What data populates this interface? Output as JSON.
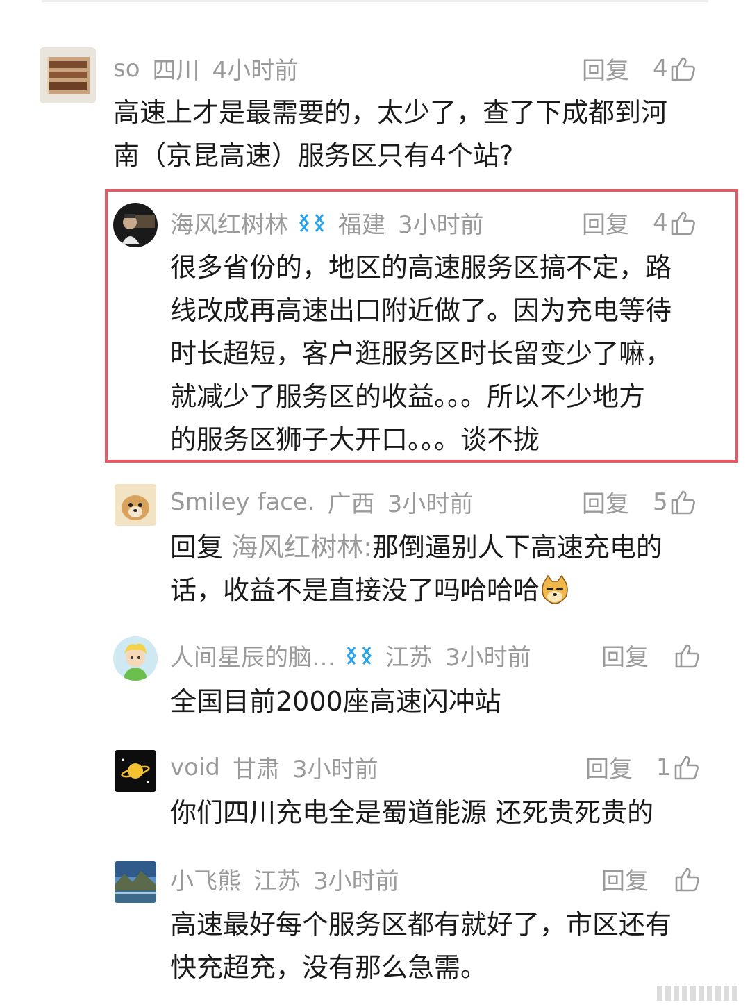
{
  "actions": {
    "reply_label": "回复"
  },
  "comments": [
    {
      "name": "so",
      "region": "四川",
      "time": "4小时前",
      "likes": "4",
      "text_lines": [
        "高速上才是最需要的，太少了，查了下成都到河",
        "南（京昆高速）服务区只有4个站?"
      ]
    },
    {
      "name": "海风红树林",
      "region": "福建",
      "time": "3小时前",
      "likes": "4",
      "text_lines": [
        "很多省份的，地区的高速服务区搞不定，路",
        "线改成再高速出口附近做了。因为充电等待",
        "时长超短，客户逛服务区时长留变少了嘛，",
        "就减少了服务区的收益。。。所以不少地方",
        "的服务区狮子大开口。。。谈不拢"
      ]
    },
    {
      "name": "Smiley face.",
      "region": "广西",
      "time": "3小时前",
      "likes": "5",
      "reply_prefix": "回复",
      "reply_to": "海风红树林:",
      "text_lines": [
        "那倒逼别人下高速充电的",
        "话，收益不是直接没了吗哈哈哈"
      ]
    },
    {
      "name": "人间星辰的脑…",
      "region": "江苏",
      "time": "3小时前",
      "likes": "",
      "text_lines": [
        "全国目前2000座高速闪冲站"
      ]
    },
    {
      "name": "void",
      "region": "甘肃",
      "time": "3小时前",
      "likes": "1",
      "text_lines": [
        "你们四川充电全是蜀道能源 还死贵死贵的"
      ]
    },
    {
      "name": "小飞熊",
      "region": "江苏",
      "time": "3小时前",
      "likes": "",
      "text_lines": [
        "高速最好每个服务区都有就好了，市区还有",
        "快充超充，没有那么急需。"
      ]
    }
  ],
  "colors": {
    "highlight_border": "#e05c66",
    "meta_gray": "#9a9a9a",
    "vip_blue": "#2aa3e8"
  },
  "icons": {
    "like": "thumbs-up-icon",
    "vip": "vip-badge-icon",
    "emoji": "doge-emoji"
  }
}
